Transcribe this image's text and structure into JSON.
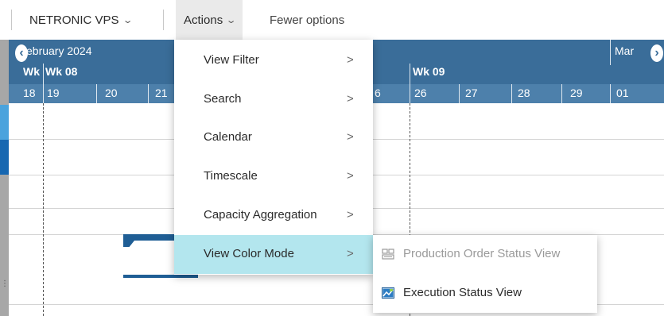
{
  "toolbar": {
    "company_label": "NETRONIC VPS",
    "actions_label": "Actions",
    "fewer_label": "Fewer options"
  },
  "gantt": {
    "month_left": "ebruary 2024",
    "month_right": "Mar",
    "week_labels": [
      "Wk",
      "Wk 08",
      "Wk 09"
    ],
    "day_labels": [
      "18",
      "19",
      "20",
      "21",
      "6",
      "26",
      "27",
      "28",
      "29",
      "01"
    ]
  },
  "menu": {
    "items": [
      {
        "label": "View Filter",
        "arrow": ">"
      },
      {
        "label": "Search",
        "arrow": ">"
      },
      {
        "label": "Calendar",
        "arrow": ">"
      },
      {
        "label": "Timescale",
        "arrow": ">"
      },
      {
        "label": "Capacity Aggregation",
        "arrow": ">"
      },
      {
        "label": "View Color Mode",
        "arrow": ">"
      }
    ]
  },
  "submenu": {
    "items": [
      {
        "label": "Production Order Status View",
        "enabled": false
      },
      {
        "label": "Execution Status View",
        "enabled": true
      }
    ]
  },
  "colors": {
    "header_bg": "#3a6d99",
    "dayrow_bg": "#4d80ab",
    "menu_active": "#b3e6ee",
    "bar": "#1f5e95"
  }
}
